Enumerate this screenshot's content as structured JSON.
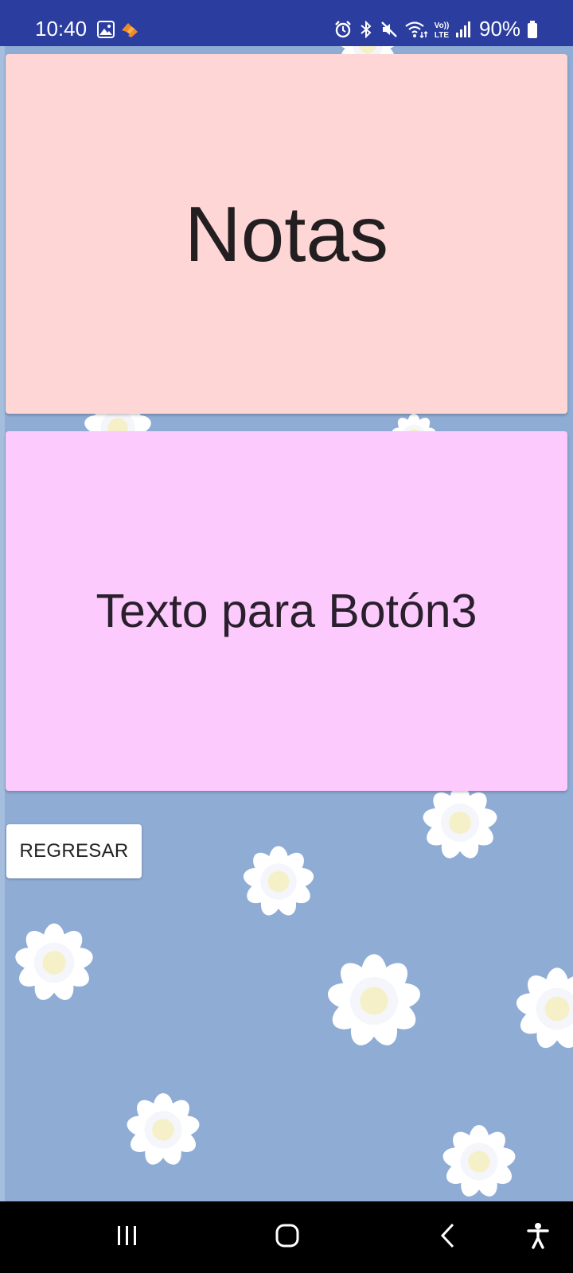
{
  "status_bar": {
    "time": "10:40",
    "battery": "90%",
    "icons": [
      "image-icon",
      "app-notification-icon",
      "alarm-icon",
      "bluetooth-icon",
      "mute-icon",
      "wifi-icon",
      "volte-icon",
      "signal-icon",
      "battery-icon"
    ],
    "background_color": "#2b3d9f"
  },
  "main": {
    "notes_card": {
      "label": "Notas",
      "color": "#fed6d6"
    },
    "text_card": {
      "label": "Texto para Botón3",
      "color": "#fccafd"
    },
    "back_button": {
      "label": "REGRESAR"
    },
    "background": {
      "color": "#8facd4",
      "pattern": "white daisies"
    }
  },
  "nav_bar": {
    "buttons": [
      "recent-apps-icon",
      "home-icon",
      "back-icon",
      "accessibility-icon"
    ]
  }
}
